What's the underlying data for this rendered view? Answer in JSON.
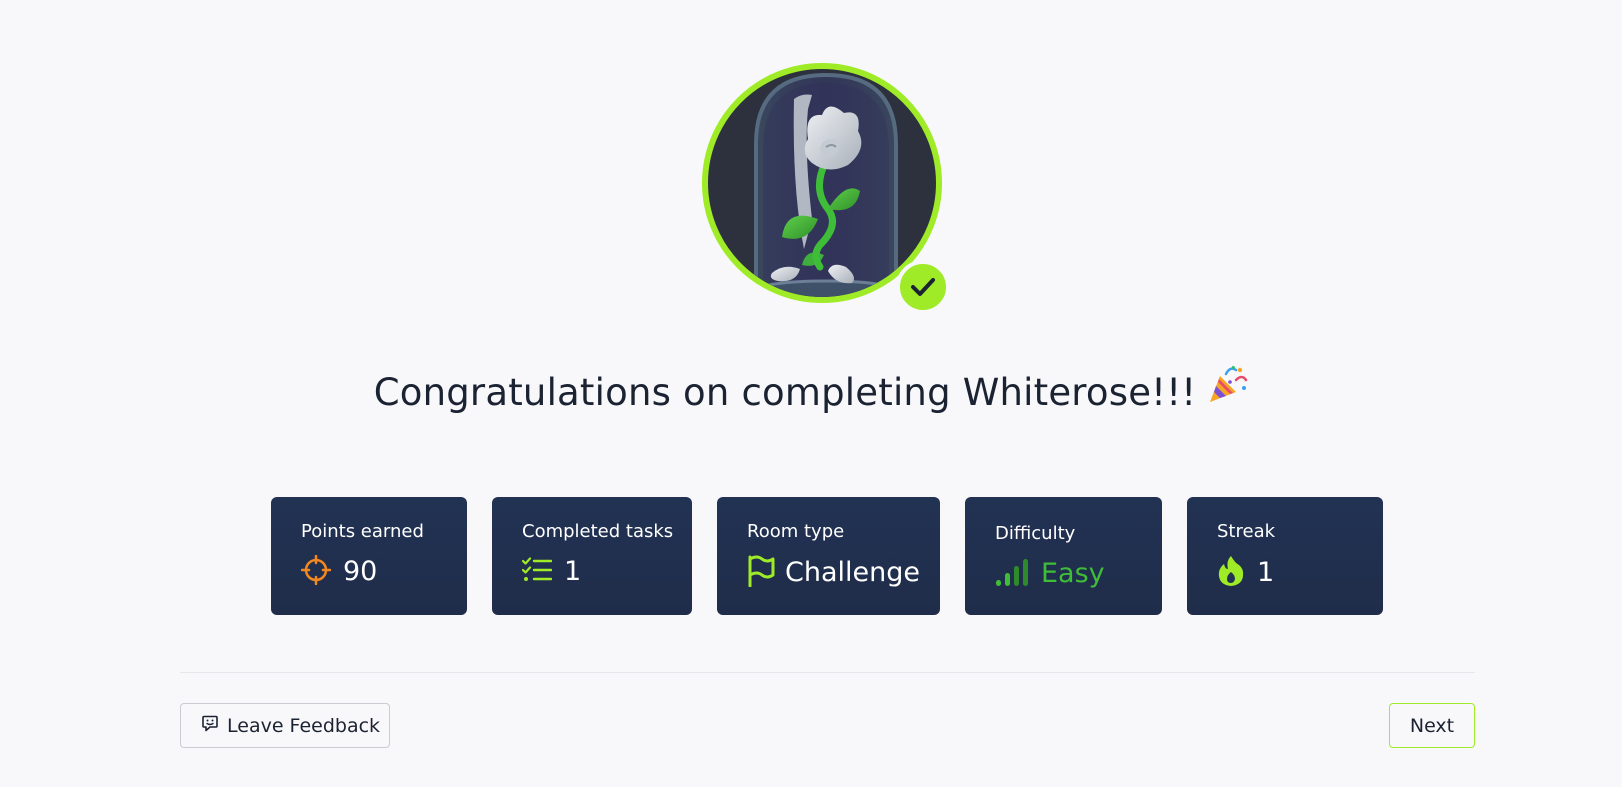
{
  "badge": {
    "name": "Whiterose",
    "completed": true,
    "accent_color": "#9feb27"
  },
  "title": {
    "text": "Congratulations on completing Whiterose!!!",
    "emoji": "party-popper"
  },
  "stats": {
    "points": {
      "label": "Points earned",
      "value": "90",
      "icon": "crosshair-icon",
      "icon_color": "#f5871f"
    },
    "tasks": {
      "label": "Completed tasks",
      "value": "1",
      "icon": "checklist-icon",
      "icon_color": "#9feb27"
    },
    "room_type": {
      "label": "Room type",
      "value": "Challenge",
      "icon": "flag-icon",
      "icon_color": "#9feb27"
    },
    "difficulty": {
      "label": "Difficulty",
      "value": "Easy",
      "icon": "signal-bars-icon",
      "color": "#3fbd38"
    },
    "streak": {
      "label": "Streak",
      "value": "1",
      "icon": "flame-icon",
      "icon_color": "#9feb27"
    }
  },
  "actions": {
    "feedback_label": "Leave Feedback",
    "next_label": "Next"
  }
}
